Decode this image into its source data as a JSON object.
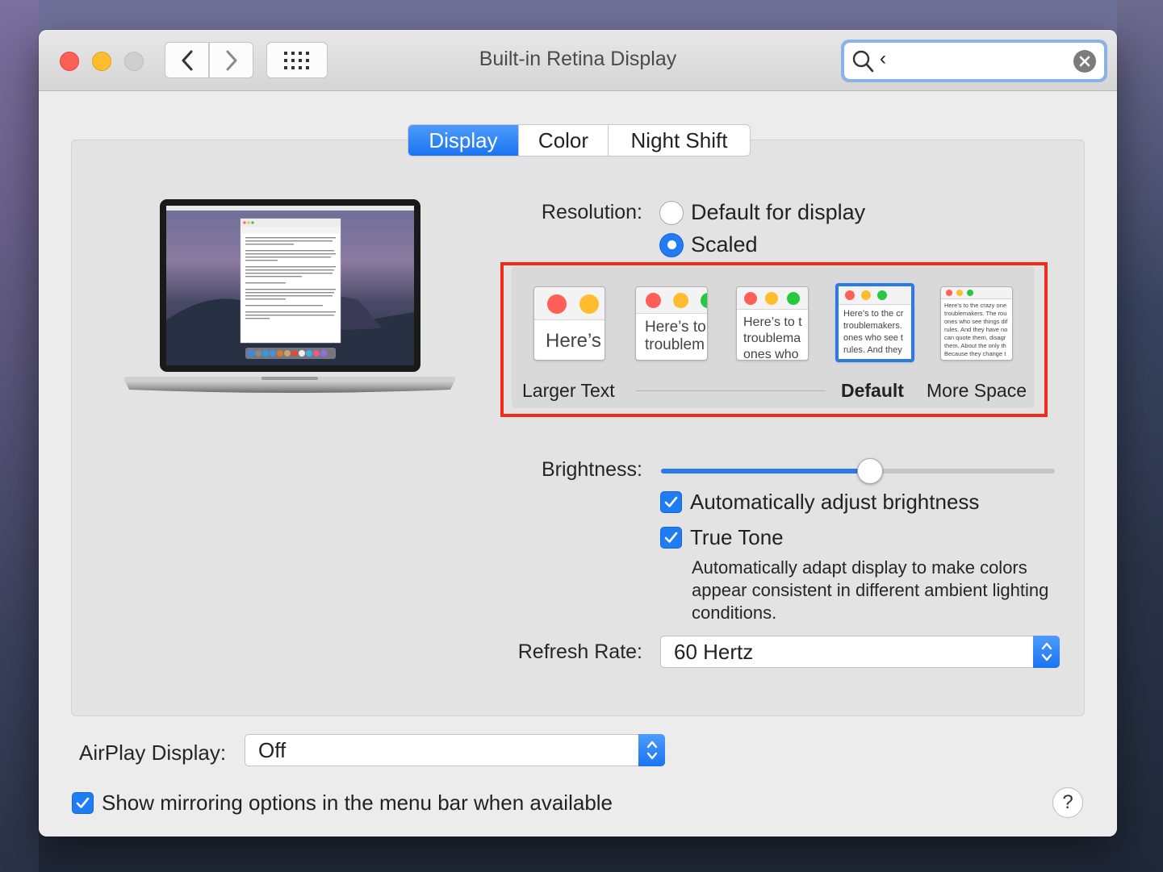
{
  "window": {
    "title": "Built-in Retina Display"
  },
  "search": {
    "query": "‹"
  },
  "tabs": [
    {
      "label": "Display",
      "active": true
    },
    {
      "label": "Color",
      "active": false
    },
    {
      "label": "Night Shift",
      "active": false
    }
  ],
  "resolution": {
    "label": "Resolution:",
    "options": [
      {
        "label": "Default for display",
        "selected": false
      },
      {
        "label": "Scaled",
        "selected": true
      }
    ]
  },
  "scaled": {
    "thumbnails": [
      {
        "text1": "Here’s",
        "text2": ""
      },
      {
        "text1": "Here’s to",
        "text2": "troublem"
      },
      {
        "text1": "Here’s to t",
        "text2": "troublema",
        "text3": "ones who"
      },
      {
        "text1": "Here’s to the cr",
        "text2": "troublemakers.",
        "text3": "ones who see t",
        "text4": "rules. And they"
      },
      {
        "lines": [
          "Here’s to the crazy one",
          "troublemakers. The rou",
          "ones who see things dif",
          "rules. And they have no",
          "can quote them, disagr",
          "them. About the only th",
          "Because they change t"
        ]
      }
    ],
    "selected_index": 3,
    "labels": {
      "larger": "Larger Text",
      "default": "Default",
      "more": "More Space"
    }
  },
  "brightness": {
    "label": "Brightness:",
    "level": 0.53,
    "auto_label": "Automatically adjust brightness",
    "auto_checked": true,
    "true_tone_label": "True Tone",
    "true_tone_checked": true,
    "true_tone_desc": "Automatically adapt display to make colors appear consistent in different ambient lighting conditions."
  },
  "refresh": {
    "label": "Refresh Rate:",
    "value": "60 Hertz"
  },
  "airplay": {
    "label": "AirPlay Display:",
    "value": "Off"
  },
  "mirroring": {
    "label": "Show mirroring options in the menu bar when available",
    "checked": true
  },
  "help": {
    "label": "?"
  },
  "colors": {
    "accent": "#1f7cf4",
    "highlight": "#f12c1c"
  }
}
